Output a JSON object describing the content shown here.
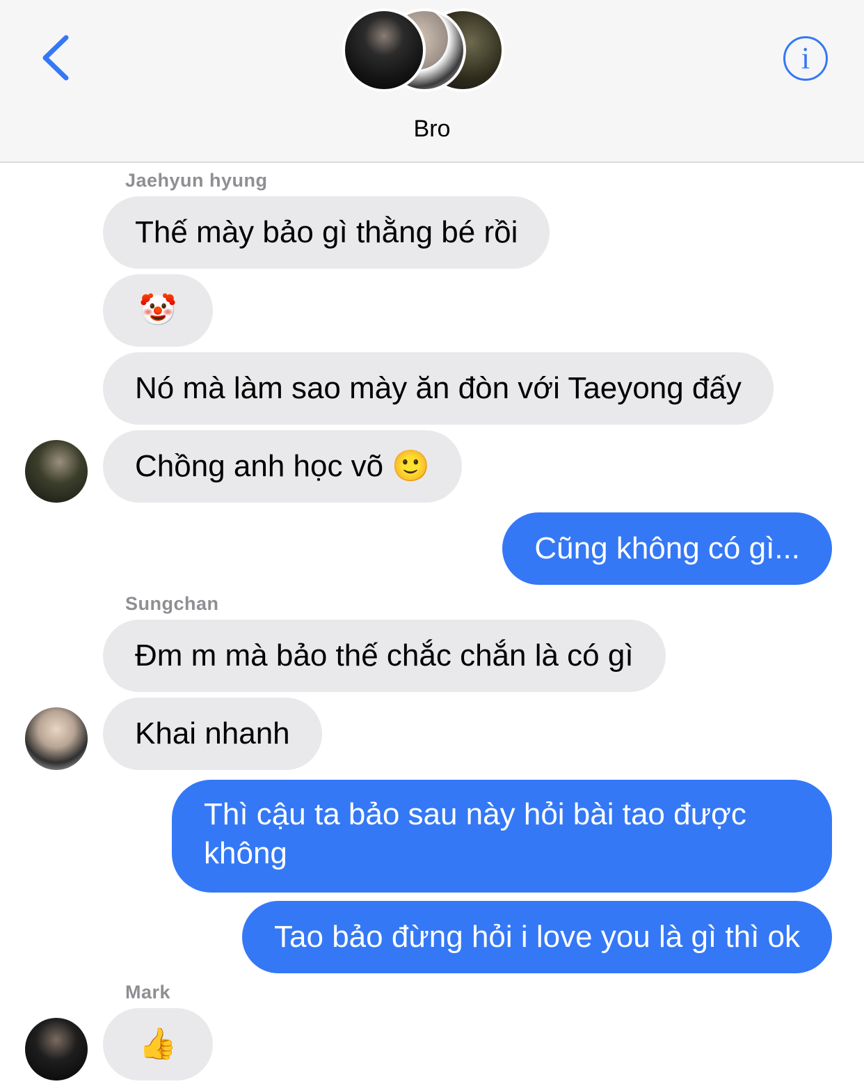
{
  "header": {
    "title": "Bro",
    "back_icon": "chevron-left-icon",
    "info_icon": "info-icon",
    "info_glyph": "i",
    "accent": "#3478f6"
  },
  "messages": [
    {
      "sender": "Jaehyun hyung",
      "text": "Thế mày bảo gì thằng bé rồi",
      "side": "incoming"
    },
    {
      "text": "🤡",
      "side": "incoming"
    },
    {
      "text": "Nó mà làm sao mày ăn đòn với Taeyong đấy",
      "side": "incoming"
    },
    {
      "text": "Chồng anh học võ 🙂",
      "side": "incoming"
    },
    {
      "text": "Cũng không có gì...",
      "side": "outgoing"
    },
    {
      "sender": "Sungchan",
      "text": "Đm m mà bảo thế chắc chắn là có gì",
      "side": "incoming"
    },
    {
      "text": "Khai nhanh",
      "side": "incoming"
    },
    {
      "text": "Thì cậu ta bảo sau này hỏi bài tao được không",
      "side": "outgoing"
    },
    {
      "text": "Tao bảo đừng hỏi i love you là gì thì ok",
      "side": "outgoing"
    },
    {
      "sender": "Mark",
      "text": "👍",
      "side": "incoming"
    }
  ],
  "colors": {
    "incoming_bubble": "#e9e9eb",
    "outgoing_bubble": "#3478f6",
    "sender_label": "#8e8e93"
  }
}
